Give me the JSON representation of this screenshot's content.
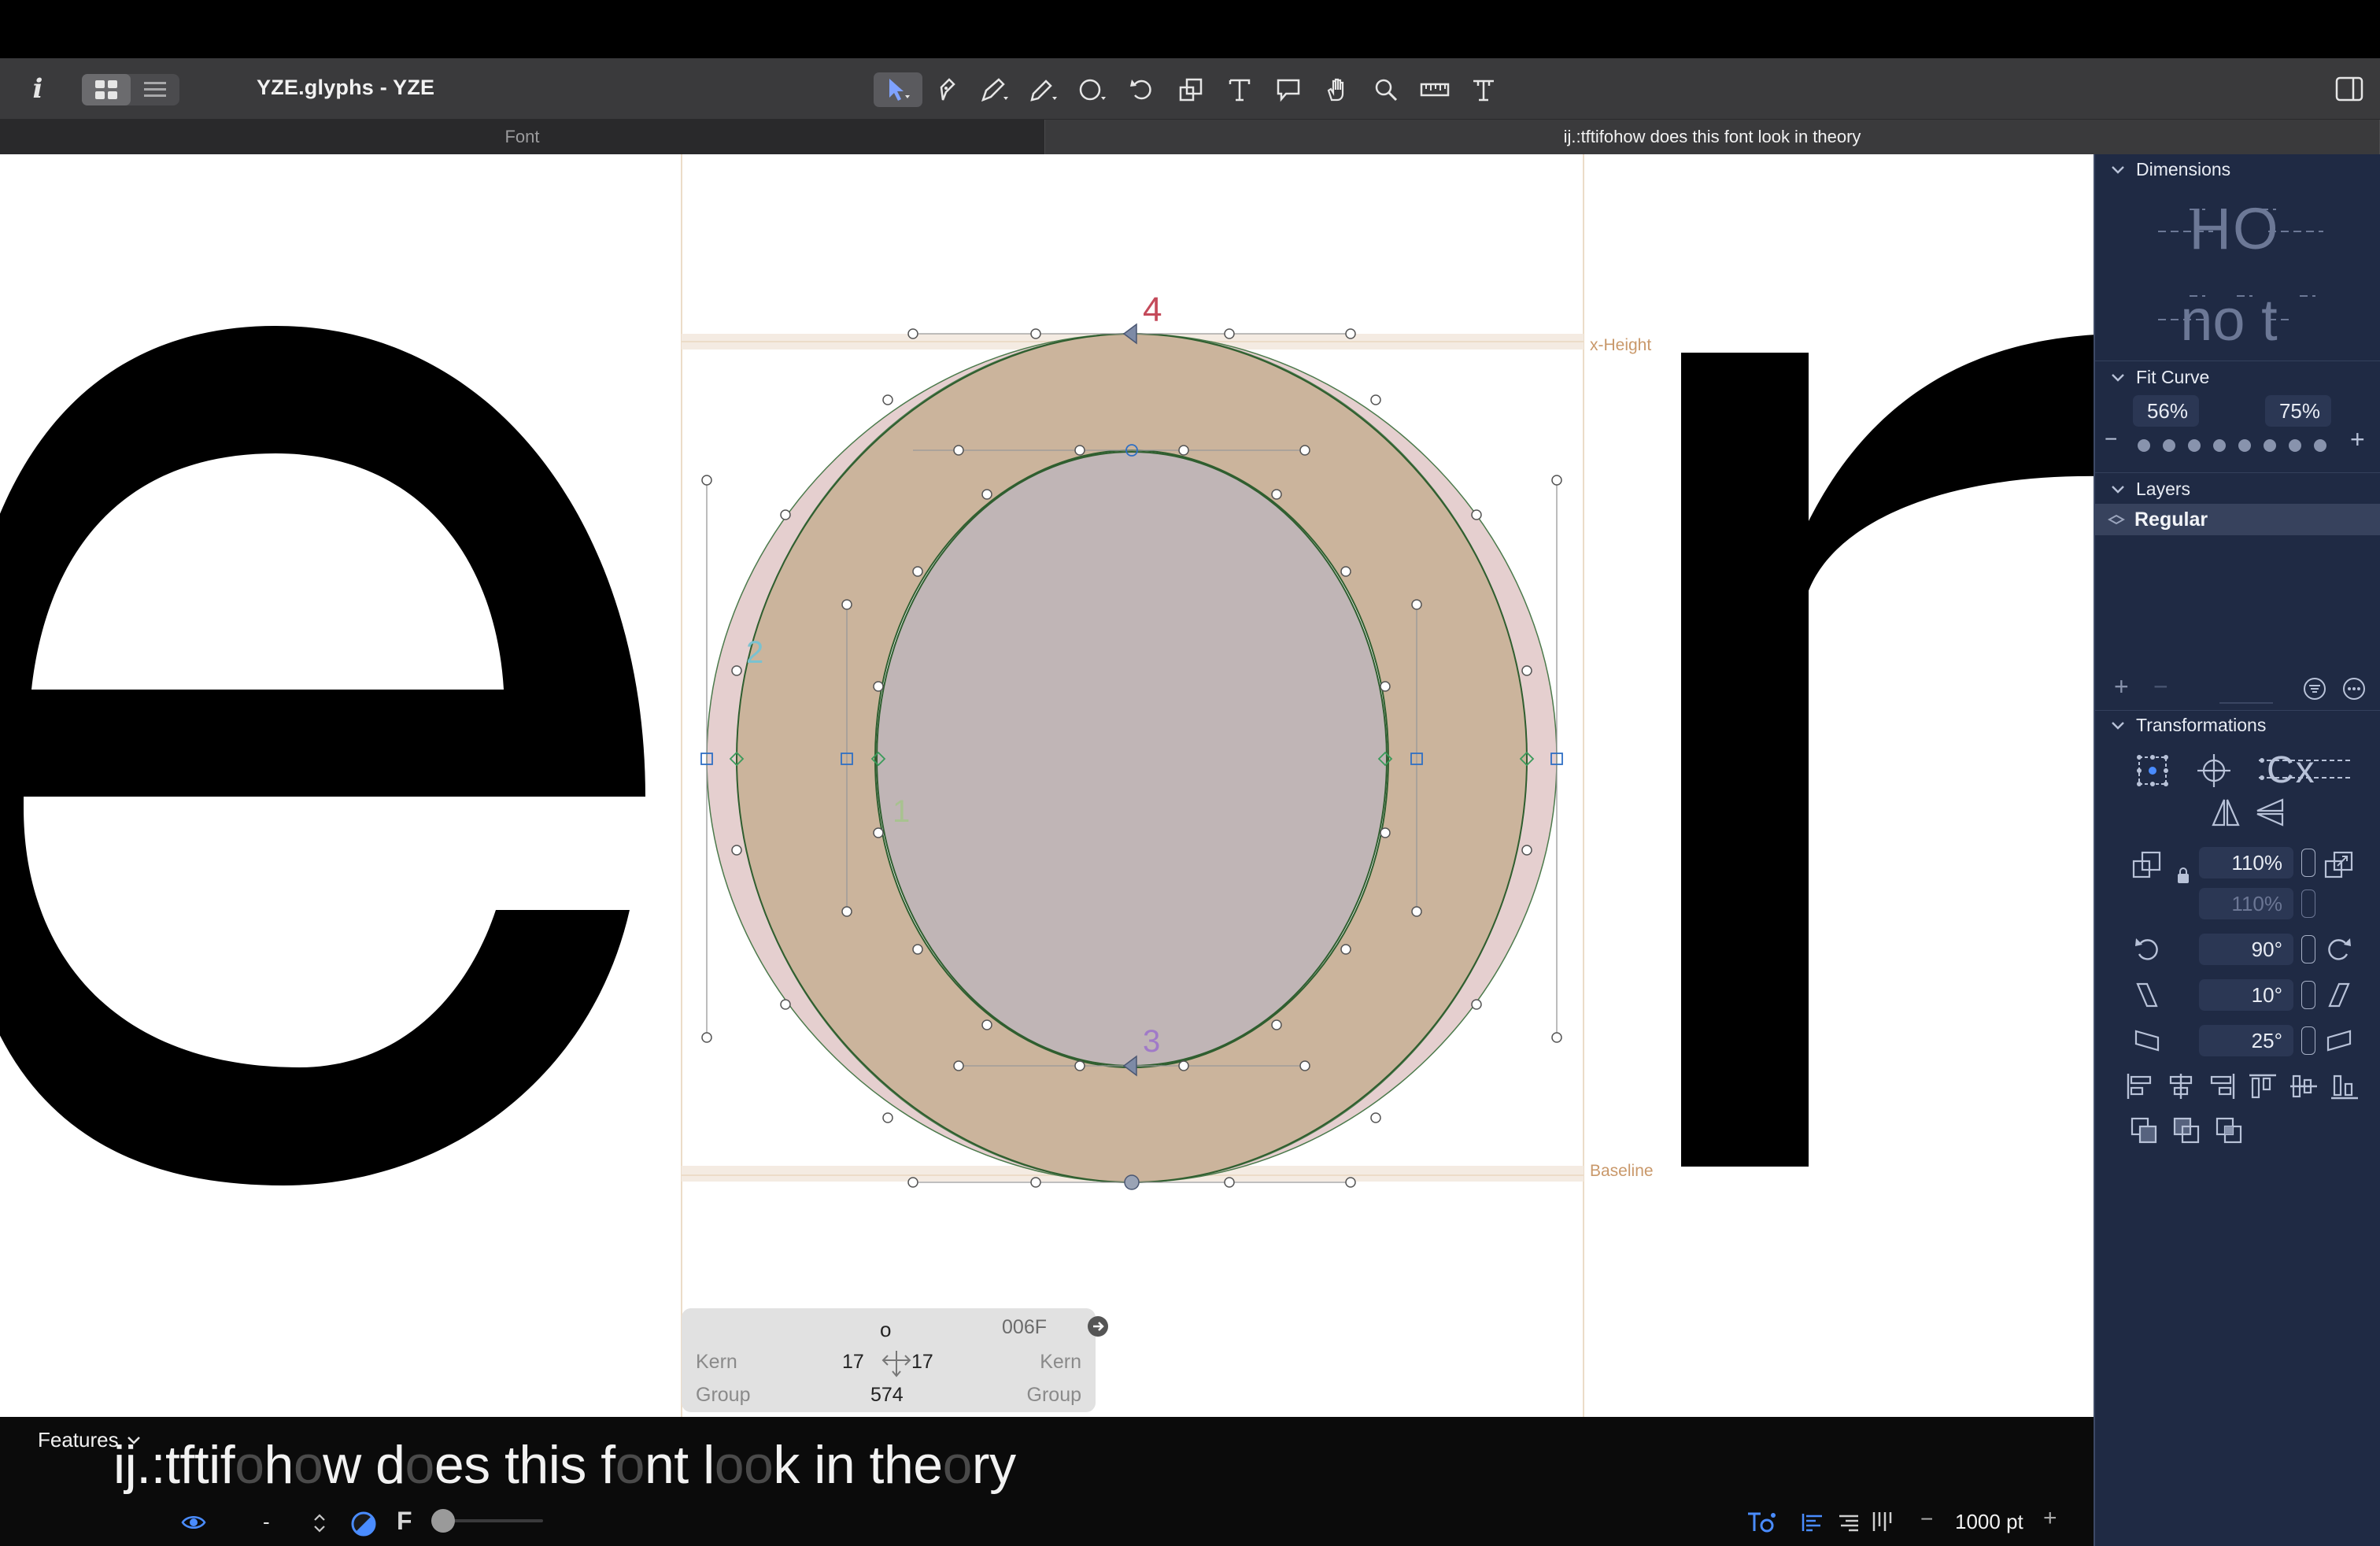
{
  "window": {
    "title": "YZE.glyphs - YZE"
  },
  "toolbar": {
    "info_icon": "info-icon",
    "tools": [
      "select-tool",
      "draw-pen-tool",
      "pen-tool",
      "pencil-tool",
      "primitives-tool",
      "rotate-tool",
      "scale-tool",
      "text-tool",
      "annotation-tool",
      "hand-tool",
      "zoom-tool",
      "measure-tool",
      "text-on-path-tool"
    ],
    "active_tool": "select-tool"
  },
  "tabs": [
    {
      "label": "Font",
      "active": false
    },
    {
      "label": "ij.:tftifohow does this font look in theory",
      "active": true
    }
  ],
  "canvas": {
    "left_glyph": "e",
    "right_glyph": "r",
    "metrics": {
      "xheight_label": "x-Height",
      "baseline_label": "Baseline"
    },
    "node_labels": [
      "1",
      "2",
      "3",
      "4"
    ],
    "colors": {
      "outer_fill": "#cbb49c",
      "inner_fill": "#c0b5b6",
      "green_ring": "#a8b0a0",
      "pink_ring": "#e5cfcf",
      "metric_band": "#f4ebe2"
    }
  },
  "glyph_info": {
    "name": "o",
    "unicode": "006F",
    "left_kern_label": "Kern",
    "right_kern_label": "Kern",
    "left_sb": "17",
    "right_sb": "17",
    "width": "574",
    "left_group_label": "Group",
    "right_group_label": "Group"
  },
  "preview": {
    "segments": [
      {
        "text": "ij.:tftif",
        "active": false
      },
      {
        "text": "o",
        "active": true
      },
      {
        "text": "h",
        "active": false
      },
      {
        "text": "o",
        "active": true
      },
      {
        "text": "w d",
        "active": false
      },
      {
        "text": "o",
        "active": true
      },
      {
        "text": "es this f",
        "active": false
      },
      {
        "text": "o",
        "active": true
      },
      {
        "text": "nt l",
        "active": false
      },
      {
        "text": "oo",
        "active": true
      },
      {
        "text": "k in the",
        "active": false
      },
      {
        "text": "o",
        "active": true
      },
      {
        "text": "ry",
        "active": false
      }
    ]
  },
  "bottombar": {
    "features_label": "Features",
    "dash_label": "-",
    "f_label": "F",
    "zoom_minus": "−",
    "zoom_value": "1000 pt",
    "zoom_plus": "+"
  },
  "inspector": {
    "dimensions": {
      "title": "Dimensions",
      "sample_top": "HO",
      "sample_bottom": "no t"
    },
    "fit_curve": {
      "title": "Fit Curve",
      "min": "56%",
      "max": "75%",
      "minus": "−",
      "plus": "+"
    },
    "layers": {
      "title": "Layers",
      "items": [
        "Regular"
      ],
      "add": "+",
      "remove": "−"
    },
    "transformations": {
      "title": "Transformations",
      "scale_x": "110%",
      "scale_y": "110%",
      "rotate": "90°",
      "slant_h": "10°",
      "slant_v": "25°"
    }
  }
}
